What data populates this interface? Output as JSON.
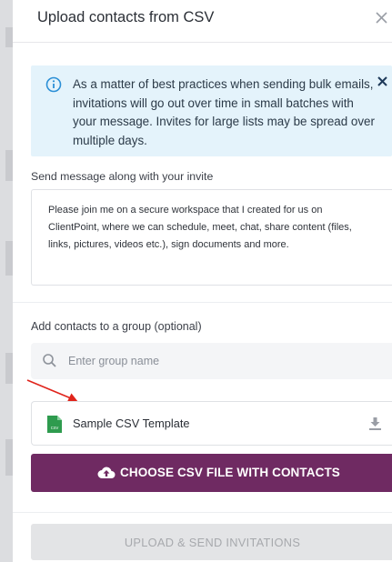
{
  "dialog": {
    "title": "Upload contacts from CSV"
  },
  "notice": {
    "text": "As a matter of best practices when sending bulk emails, invitations will go out over time in small batches with your message. Invites for large lists may be spread over multiple days."
  },
  "message_section": {
    "label": "Send message along with your invite",
    "body": "Please join me on a secure workspace that I created for us on ClientPoint, where we can schedule, meet, chat, share content (files, links, pictures, videos etc.), sign documents and more."
  },
  "group_section": {
    "label": "Add contacts to a group (optional)",
    "placeholder": "Enter group name",
    "value": ""
  },
  "template": {
    "label": "Sample CSV Template",
    "icon_text": "CSV"
  },
  "buttons": {
    "choose": "CHOOSE CSV FILE WITH CONTACTS",
    "upload": "UPLOAD & SEND INVITATIONS"
  },
  "colors": {
    "accent": "#6f2a62",
    "info_bg": "#e4f3fb",
    "info_icon": "#2b8fd6",
    "csv_icon": "#2e9b4e",
    "annotation_arrow": "#e0241b",
    "disabled_button": "#e3e4e6"
  },
  "icons": [
    "close-icon",
    "info-icon",
    "search-icon",
    "csv-file-icon",
    "download-icon",
    "cloud-upload-icon"
  ]
}
